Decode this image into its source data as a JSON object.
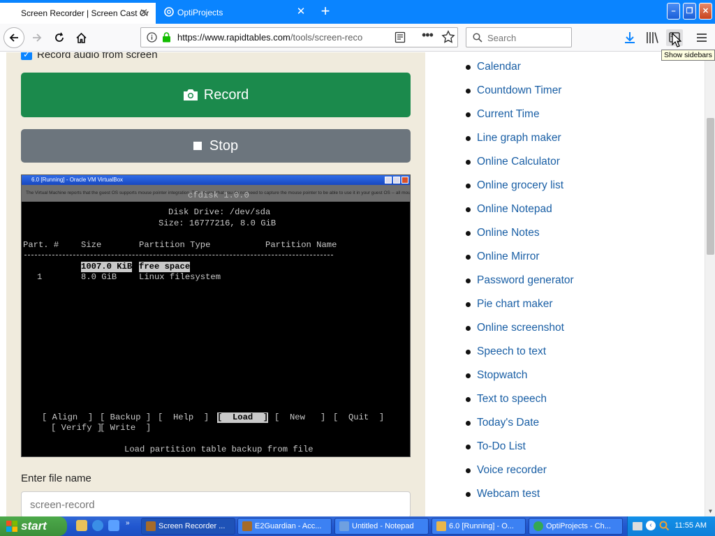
{
  "browser": {
    "tabs": [
      {
        "label": "Screen Recorder | Screen Cast Or"
      },
      {
        "label": "OptiProjects"
      }
    ],
    "url": {
      "host": "https://www.rapidtables.com",
      "path": "/tools/screen-reco"
    },
    "search_placeholder": "Search",
    "tooltip": "Show sidebars",
    "colors": {
      "tabbar": "#0a84ff",
      "record": "#1b8a4c",
      "stop": "#6c757d",
      "link": "#1a5fa5"
    }
  },
  "page": {
    "audio_label": "Record audio from screen",
    "record_label": "Record",
    "stop_label": "Stop",
    "filename_label": "Enter file name",
    "filename_placeholder": "screen-record",
    "links": [
      "Calendar",
      "Countdown Timer",
      "Current Time",
      "Line graph maker",
      "Online Calculator",
      "Online grocery list",
      "Online Notepad",
      "Online Notes",
      "Online Mirror",
      "Password generator",
      "Pie chart maker",
      "Online screenshot",
      "Speech to text",
      "Stopwatch",
      "Text to speech",
      "Today's Date",
      "To-Do List",
      "Voice recorder",
      "Webcam test"
    ]
  },
  "vm": {
    "title": "6.0 [Running] - Oracle VM VirtualBox",
    "notice": "The Virtual Machine reports that the guest OS supports mouse pointer integration. This means that you do not need to capture the mouse pointer to be able to use it in your guest OS -- all mouse",
    "banner": "cfdisk 1.0.0",
    "disk_drive": "Disk Drive: /dev/sda",
    "size": "Size: 16777216, 8.0 GiB",
    "headers": {
      "part": "Part. #",
      "size": "Size",
      "type": "Partition Type",
      "name": "Partition Name"
    },
    "rows": [
      {
        "part": "",
        "size": "1007.0 KiB",
        "type": "free space"
      },
      {
        "part": "1",
        "size": "8.0 GiB",
        "type": "Linux filesystem"
      }
    ],
    "menu": {
      "align": "[ Align  ]",
      "backup": "[ Backup ]",
      "help": "[  Help  ]",
      "load": "[  Load  ]",
      "new": "[  New   ]",
      "quit": "[  Quit  ]",
      "verify": "[ Verify ]",
      "write": "[ Write  ]"
    },
    "status": "Load partition table backup from file"
  },
  "taskbar": {
    "start_label": "start",
    "tasks": [
      {
        "label": "Screen Recorder ...",
        "icon_color": "#a56b2a"
      },
      {
        "label": "E2Guardian - Acc...",
        "icon_color": "#a56b2a"
      },
      {
        "label": "Untitled - Notepad",
        "icon_color": "#6fa0e0"
      },
      {
        "label": "6.0 [Running] - O...",
        "icon_color": "#e8b64b"
      },
      {
        "label": "OptiProjects - Ch...",
        "icon_color": "#35a853"
      }
    ],
    "clock": "11:55 AM"
  }
}
